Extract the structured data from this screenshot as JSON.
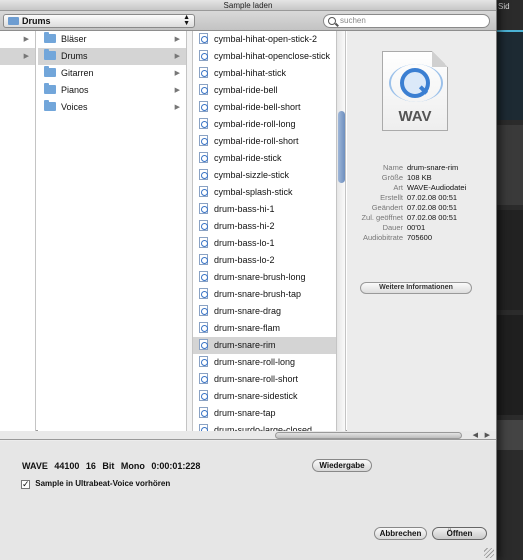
{
  "window": {
    "title": "Sample laden"
  },
  "background_app": {
    "title": "Sid",
    "accent": "#4bb3d6"
  },
  "toolbar": {
    "path": "Drums",
    "search_placeholder": "suchen"
  },
  "columns": {
    "col2": [
      "Bläser",
      "Drums",
      "Gitarren",
      "Pianos",
      "Voices"
    ],
    "col2_selected": "Drums",
    "col3": [
      "cymbal-hihat-open-stick-2",
      "cymbal-hihat-openclose-stick",
      "cymbal-hihat-stick",
      "cymbal-ride-bell",
      "cymbal-ride-bell-short",
      "cymbal-ride-roll-long",
      "cymbal-ride-roll-short",
      "cymbal-ride-stick",
      "cymbal-sizzle-stick",
      "cymbal-splash-stick",
      "drum-bass-hi-1",
      "drum-bass-hi-2",
      "drum-bass-lo-1",
      "drum-bass-lo-2",
      "drum-snare-brush-long",
      "drum-snare-brush-tap",
      "drum-snare-drag",
      "drum-snare-flam",
      "drum-snare-rim",
      "drum-snare-roll-long",
      "drum-snare-roll-short",
      "drum-snare-sidestick",
      "drum-snare-tap",
      "drum-surdo-large-closed"
    ],
    "col3_selected": "drum-snare-rim"
  },
  "preview": {
    "icon_label": "WAV",
    "meta": [
      {
        "key": "Name",
        "value": "drum-snare-rim"
      },
      {
        "key": "Größe",
        "value": "108 KB"
      },
      {
        "key": "Art",
        "value": "WAVE-Audiodatei"
      },
      {
        "key": "Erstellt",
        "value": "07.02.08 00:51"
      },
      {
        "key": "Geändert",
        "value": "07.02.08 00:51"
      },
      {
        "key": "Zul. geöffnet",
        "value": "07.02.08 00:51"
      },
      {
        "key": "Dauer",
        "value": "00'01"
      },
      {
        "key": "Audiobitrate",
        "value": "705600"
      }
    ],
    "more_info_label": "Weitere Informationen"
  },
  "bottom": {
    "file_info": "WAVE  44100  16 Bit  Mono  0:00:01:228",
    "play_label": "Wiedergabe",
    "checkbox_label": "Sample in Ultrabeat-Voice vorhören",
    "checkbox_checked": "✓",
    "cancel_label": "Abbrechen",
    "open_label": "Öffnen"
  }
}
